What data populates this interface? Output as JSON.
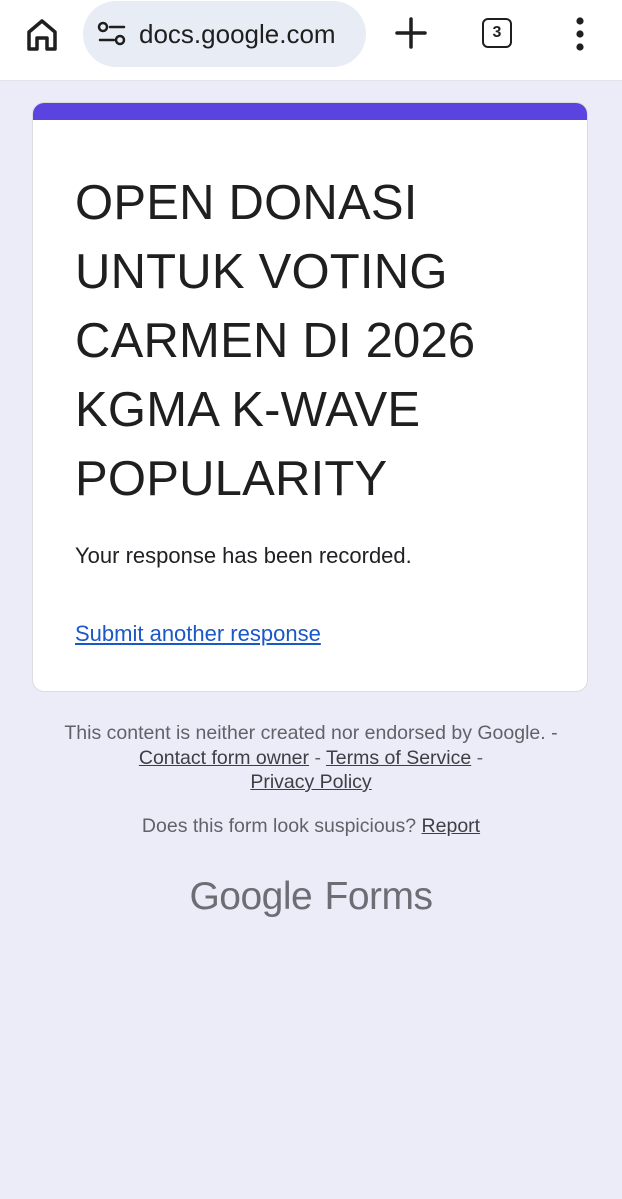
{
  "browser": {
    "url": "docs.google.com",
    "tab_count": "3",
    "icons": {
      "home": "home-icon",
      "site_settings": "tune-icon",
      "new_tab": "plus-icon",
      "menu": "more-vert-icon"
    }
  },
  "form": {
    "title": "OPEN DONASI UNTUK VOTING CARMEN DI 2026 KGMA K-WAVE POPULARITY",
    "confirmation": "Your response has been recorded.",
    "submit_another": "Submit another response",
    "accent_color": "#5b43e0"
  },
  "footer": {
    "disclaimer": "This content is neither created nor endorsed by Google. -",
    "contact_owner": "Contact form owner",
    "sep1": "-",
    "terms": "Terms of Service",
    "sep2": "-",
    "privacy": "Privacy Policy",
    "suspicious_text": "Does this form look suspicious?",
    "report": "Report",
    "brand_google": "Google",
    "brand_forms": "Forms"
  }
}
